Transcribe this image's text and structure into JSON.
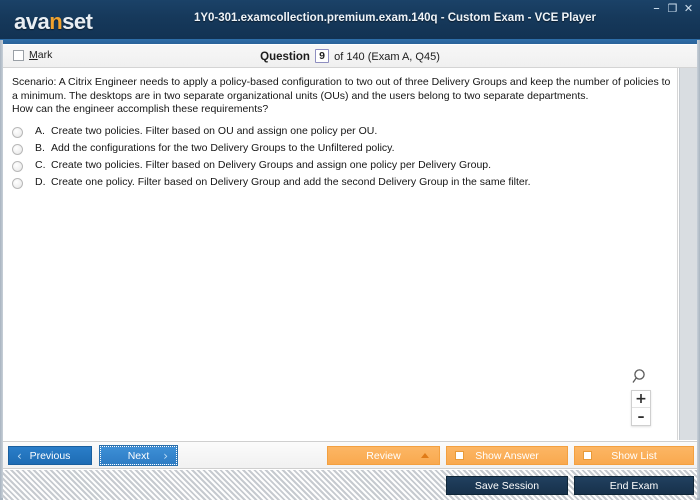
{
  "window": {
    "logo_text": "avanset",
    "logo_accent_letter": "n",
    "title": "1Y0-301.examcollection.premium.exam.140q - Custom Exam - VCE Player",
    "controls": {
      "minimize": "–",
      "maximize": "❐",
      "close": "✕"
    },
    "colors": {
      "titlebar": "#16395b",
      "accent_blue": "#2a7ec9",
      "accent_orange": "#f9a94f",
      "dark_button": "#1d3a57",
      "logo_accent": "#f0a22e"
    }
  },
  "header": {
    "mark_label_accel": "M",
    "mark_label_rest": "ark",
    "question_word": "Question",
    "question_number": "9",
    "question_suffix": "of 140 (Exam A, Q45)"
  },
  "question": {
    "line1": "Scenario: A Citrix Engineer needs to apply a policy-based configuration to two out of three Delivery Groups and keep the number of policies to a minimum. The desktops are in two separate organizational units (OUs) and the users belong to two separate departments.",
    "line2": "How can the engineer accomplish these requirements?",
    "options": [
      {
        "letter": "A.",
        "text": "Create two policies. Filter based on OU and assign one policy per OU.",
        "selected": false
      },
      {
        "letter": "B.",
        "text": "Add the configurations for the two Delivery Groups to the Unfiltered policy.",
        "selected": false
      },
      {
        "letter": "C.",
        "text": "Create two policies. Filter based on Delivery Groups and assign one policy per Delivery Group.",
        "selected": false
      },
      {
        "letter": "D.",
        "text": "Create one policy. Filter based on Delivery Group and add the second Delivery Group in the same filter.",
        "selected": false
      }
    ]
  },
  "zoom_widget": {
    "magnifier_icon": "magnifier-icon",
    "zoom_in": "+",
    "zoom_out": "–"
  },
  "toolbar": {
    "previous_label": "Previous",
    "previous_chevron": "‹",
    "next_label": "Next",
    "next_chevron": "›",
    "review_label": "Review",
    "show_answer_label": "Show Answer",
    "show_list_label": "Show List"
  },
  "statusbar": {
    "save_session_label": "Save Session",
    "end_exam_label": "End Exam"
  }
}
